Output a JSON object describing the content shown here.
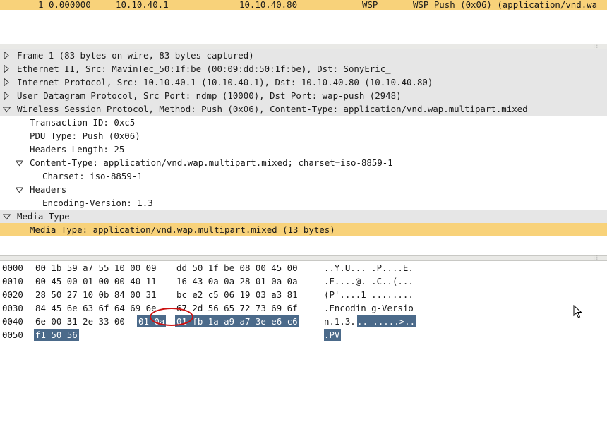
{
  "packet_list": {
    "row": {
      "no": "1",
      "time": "0.000000",
      "source": "10.10.40.1",
      "destination": "10.10.40.80",
      "protocol": "WSP",
      "info": "WSP Push (0x06) (application/vnd.wa"
    }
  },
  "details": [
    {
      "text": "Frame 1 (83 bytes on wire, 83 bytes captured)",
      "state": "collapsed"
    },
    {
      "text": "Ethernet II, Src: MavinTec_50:1f:be (00:09:dd:50:1f:be), Dst: SonyEric_",
      "state": "collapsed"
    },
    {
      "text": "Internet Protocol, Src: 10.10.40.1 (10.10.40.1), Dst: 10.10.40.80 (10.10.40.80)",
      "state": "collapsed"
    },
    {
      "text": "User Datagram Protocol, Src Port: ndmp (10000), Dst Port: wap-push (2948)",
      "state": "collapsed"
    },
    {
      "text": "Wireless Session Protocol, Method: Push (0x06), Content-Type: application/vnd.wap.multipart.mixed",
      "state": "expanded"
    },
    {
      "text": "Transaction ID: 0xc5",
      "state": "leaf"
    },
    {
      "text": "PDU Type: Push (0x06)",
      "state": "leaf"
    },
    {
      "text": "Headers Length: 25",
      "state": "leaf"
    },
    {
      "text": "Content-Type: application/vnd.wap.multipart.mixed; charset=iso-8859-1",
      "state": "expanded"
    },
    {
      "text": "Charset: iso-8859-1",
      "state": "leaf"
    },
    {
      "text": "Headers",
      "state": "expanded"
    },
    {
      "text": "Encoding-Version: 1.3",
      "state": "leaf"
    },
    {
      "text": "Media Type",
      "state": "expanded"
    },
    {
      "text": "Media Type: application/vnd.wap.multipart.mixed (13 bytes)",
      "state": "selected"
    }
  ],
  "bytes": [
    {
      "offset": "0000",
      "hex1": "00 1b 59 a7 55 10 00 09",
      "hex2": "dd 50 1f be 08 00 45 00",
      "ascii": "..Y.U... .P....E."
    },
    {
      "offset": "0010",
      "hex1": "00 45 00 01 00 00 40 11",
      "hex2": "16 43 0a 0a 28 01 0a 0a",
      "ascii": ".E....@. .C..(..."
    },
    {
      "offset": "0020",
      "hex1": "28 50 27 10 0b 84 00 31",
      "hex2": "bc e2 c5 06 19 03 a3 81",
      "ascii": "(P'....1 ........"
    },
    {
      "offset": "0030",
      "hex1": "84 45 6e 63 6f 64 69 6e",
      "hex2": "67 2d 56 65 72 73 69 6f",
      "ascii": ".Encodin g-Versio"
    },
    {
      "offset": "0040",
      "hex1_plain": "6e 00 31 2e 33 00",
      "hex1_hl": "01 0a",
      "hex2_hl": "01 fb 1a a9 a7 3e e6 c6",
      "ascii_plain": "n.1.3.",
      "ascii_hl": ".. .....>.."
    },
    {
      "offset": "0050",
      "hex1_hl": "f1 50 56",
      "ascii_hl": ".PV"
    }
  ],
  "colors": {
    "selection": "#f8d27a",
    "byte_highlight": "#4b6a8a",
    "annotation": "#cc1111"
  },
  "icons": {
    "collapsed": "triangle-right-icon",
    "expanded": "triangle-down-icon",
    "pointer": "mouse-cursor-icon"
  }
}
